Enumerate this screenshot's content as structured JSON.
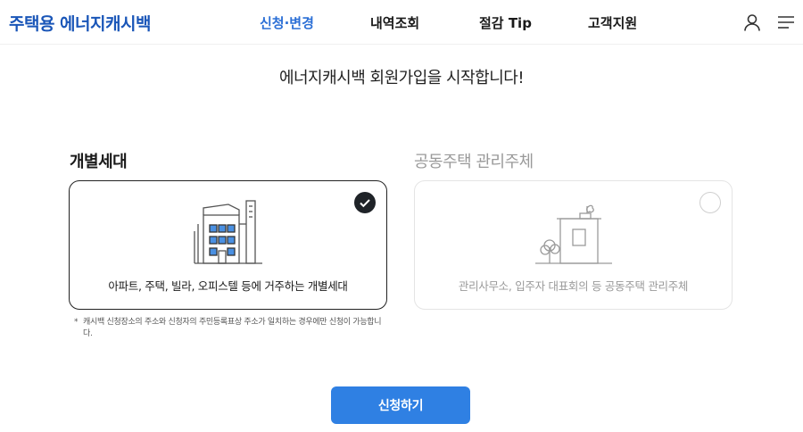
{
  "header": {
    "logo": "주택용 에너지캐시백",
    "nav": [
      {
        "label": "신청·변경",
        "active": true
      },
      {
        "label": "내역조회",
        "active": false
      },
      {
        "label": "절감 Tip",
        "active": false
      },
      {
        "label": "고객지원",
        "active": false
      }
    ],
    "icons": [
      "user-icon",
      "hamburger-menu-icon"
    ]
  },
  "main": {
    "title": "에너지캐시백 회원가입을 시작합니다!",
    "options": [
      {
        "label": "개별세대",
        "description": "아파트, 주택, 빌라, 오피스텔 등에 거주하는 개별세대",
        "selected": true,
        "icon": "apartment-building-icon"
      },
      {
        "label": "공동주택 관리주체",
        "description": "관리사무소, 입주자 대표회의 등 공동주택 관리주체",
        "selected": false,
        "icon": "management-office-icon"
      }
    ],
    "notice_star": "*",
    "notice": "캐시백 신청장소의 주소와 신청자의 주민등록표상 주소가 일치하는 경우에만 신청이 가능합니다.",
    "submit_label": "신청하기"
  },
  "colors": {
    "brand": "#1a56b8",
    "nav_active": "#2b6fd6",
    "button": "#2f80e3",
    "building_window": "#4a90e2"
  }
}
